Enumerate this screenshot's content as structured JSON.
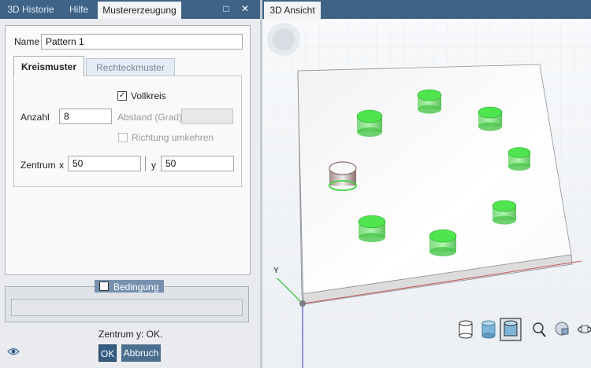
{
  "left_tabs": {
    "historie": "3D Historie",
    "hilfe": "Hilfe",
    "mustererzeugung": "Mustererzeugung"
  },
  "window_buttons": {
    "maximize": "□",
    "close": "✕"
  },
  "form": {
    "name_label": "Name",
    "name_value": "Pattern 1",
    "tab_kreismuster": "Kreismuster",
    "tab_rechteckmuster": "Rechteckmuster",
    "vollkreis_label": "Vollkreis",
    "vollkreis_checked": "✓",
    "anzahl_label": "Anzahl",
    "anzahl_value": "8",
    "abstand_label": "Abstand (Grad)",
    "abstand_value": "",
    "richtung_label": "Richtung umkehren",
    "zentrum_label": "Zentrum",
    "x_label": "x",
    "x_value": "50",
    "y_label": "y",
    "y_value": "50"
  },
  "bedingung": {
    "label": "Bedingung",
    "value": ""
  },
  "status_text": "Zentrum y: OK.",
  "buttons": {
    "ok": "OK",
    "abbruch": "Abbruch"
  },
  "right_tabs": {
    "ansicht": "3D Ansicht"
  },
  "viewport": {
    "axis_label": "Y",
    "colors": {
      "cylinder": "#3fd43f",
      "selected_cylinder": "#a07575",
      "plate_top": "#f5f5f5",
      "plate_side": "#d9d9d9"
    }
  },
  "toolbar_icons": [
    "cylinder-outline-icon",
    "cylinder-shaded-icon",
    "cylinder-selected-icon",
    "zoom-icon",
    "view-sphere-icon",
    "rotate-icon"
  ]
}
